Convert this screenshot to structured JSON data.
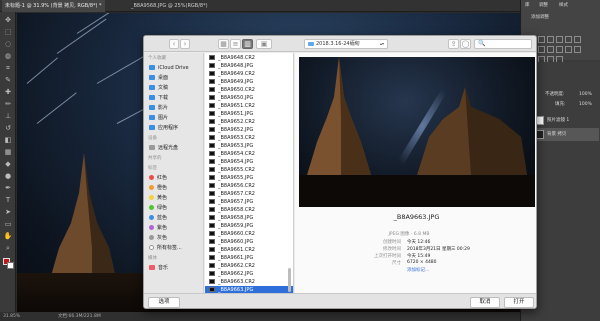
{
  "ps": {
    "tab_active": "未标题-1 @ 31.9% (背景 拷贝, RGB/8*) *",
    "tab_inactive": "_B8A9568.JPG @ 25%(RGB/8*)",
    "status_zoom": "31.85%",
    "status_doc": "文档:66.3M/221.8M",
    "panel_tab_1": "添加调整",
    "panel_tab_2": "库",
    "panel_tab_3": "调整",
    "panel_tab_4": "样式",
    "layers_title": "图层",
    "opacity_label": "不透明度:",
    "opacity_value": "100%",
    "fill_label": "填充:",
    "fill_value": "100%",
    "layers": [
      "照片滤镜 1",
      "背景 拷贝"
    ]
  },
  "dialog": {
    "folder": "2018.3.16-24缅甸",
    "search_placeholder": "🔍",
    "sidebar": {
      "personal_header": "个人收藏",
      "personal": [
        {
          "label": "iCloud Drive",
          "color": "#3a8ee6"
        },
        {
          "label": "桌面",
          "color": "#3a8ee6"
        },
        {
          "label": "文稿",
          "color": "#3a8ee6"
        },
        {
          "label": "下载",
          "color": "#3a8ee6"
        },
        {
          "label": "影片",
          "color": "#3a8ee6"
        },
        {
          "label": "图片",
          "color": "#3a8ee6"
        },
        {
          "label": "应用程序",
          "color": "#3a8ee6"
        }
      ],
      "devices_header": "设备",
      "devices": [
        {
          "label": "远程光盘",
          "color": "#9a9a9a"
        }
      ],
      "shared_header": "共享的",
      "tags_header": "标签",
      "tags": [
        {
          "label": "红色",
          "color": "#f04a4a"
        },
        {
          "label": "橙色",
          "color": "#f79a2a"
        },
        {
          "label": "黄色",
          "color": "#f4d23a"
        },
        {
          "label": "绿色",
          "color": "#52c43a"
        },
        {
          "label": "蓝色",
          "color": "#3a8ee6"
        },
        {
          "label": "紫色",
          "color": "#b064d6"
        },
        {
          "label": "灰色",
          "color": "#9a9a9a"
        },
        {
          "label": "所有标签...",
          "color": "#ffffff"
        }
      ],
      "media_header": "媒体",
      "media": [
        {
          "label": "音乐",
          "color": "#f25a6a"
        }
      ]
    },
    "files": [
      "_B8A9648.CR2",
      "_B8A9648.JPG",
      "_B8A9649.CR2",
      "_B8A9649.JPG",
      "_B8A9650.CR2",
      "_B8A9650.JPG",
      "_B8A9651.CR2",
      "_B8A9651.JPG",
      "_B8A9652.CR2",
      "_B8A9652.JPG",
      "_B8A9653.CR2",
      "_B8A9653.JPG",
      "_B8A9654.CR2",
      "_B8A9654.JPG",
      "_B8A9655.CR2",
      "_B8A9655.JPG",
      "_B8A9656.CR2",
      "_B8A9657.CR2",
      "_B8A9657.JPG",
      "_B8A9658.CR2",
      "_B8A9658.JPG",
      "_B8A9659.JPG",
      "_B8A9660.CR2",
      "_B8A9660.JPG",
      "_B8A9661.CR2",
      "_B8A9661.JPG",
      "_B8A9662.CR2",
      "_B8A9662.JPG",
      "_B8A9663.CR2",
      "_B8A9663.JPG"
    ],
    "selected_index": 29,
    "preview": {
      "name": "_B8A9663.JPG",
      "kind_value": "JPEG 图像 - 6.8 MB",
      "created_label": "创建时间",
      "created_value": "今天 12:46",
      "modified_label": "修改时间",
      "modified_value": "2018年3月21日 星期三 00:29",
      "opened_label": "上次打开时间",
      "opened_value": "今天 15:49",
      "size_label": "尺寸",
      "size_value": "6720 × 4480",
      "add_tags": "添加标记..."
    },
    "options_label": "选项",
    "cancel_label": "取消",
    "open_label": "打开"
  }
}
